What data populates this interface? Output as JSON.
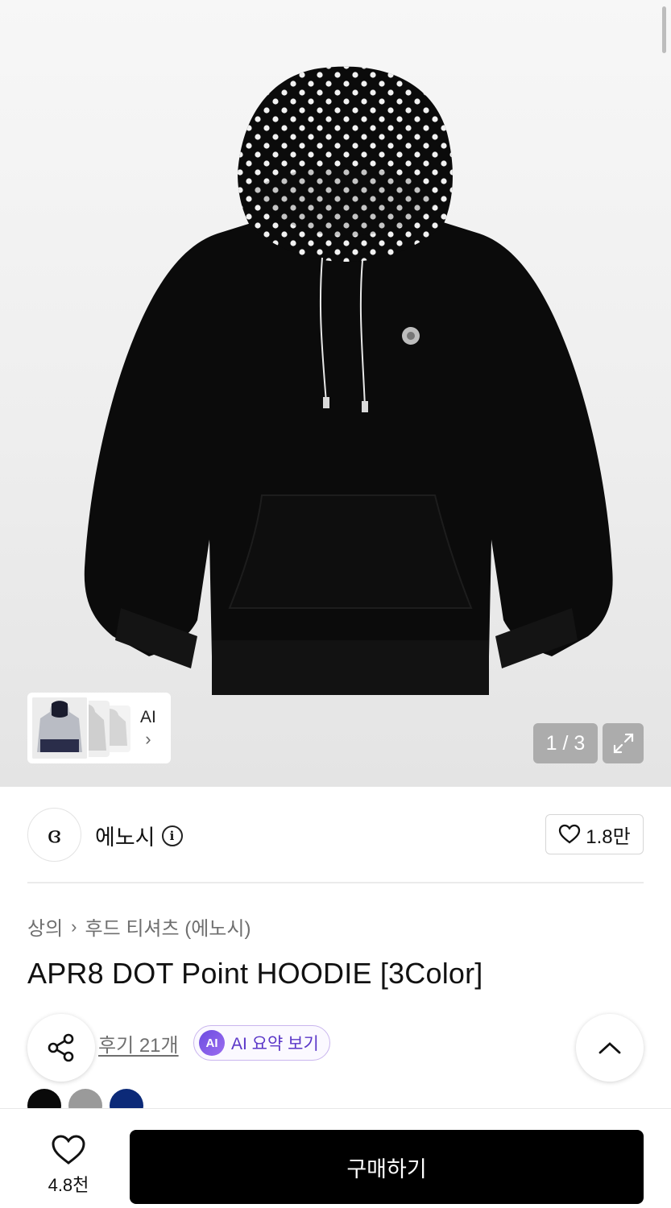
{
  "gallery": {
    "counter": "1 / 3",
    "ai_thumb_label": "AI",
    "ai_thumb_chevron": "›"
  },
  "brand": {
    "logo_glyph": "ɞ",
    "name": "에노시",
    "info_glyph": "i",
    "likes": "1.8만"
  },
  "breadcrumb": {
    "category": "상의",
    "separator": "›",
    "subcategory": "후드 티셔츠 (에노시)"
  },
  "product": {
    "title": "APR8 DOT Point HOODIE [3Color]"
  },
  "reviews": {
    "link": "후기 21개",
    "ai_badge": "AI",
    "ai_summary": "AI 요약 보기"
  },
  "colors": {
    "swatches": [
      "#0a0a0a",
      "#9a9a9a",
      "#0c2a78"
    ],
    "accent": "#6c4de0"
  },
  "bottom_bar": {
    "wish_count": "4.8천",
    "buy_label": "구매하기"
  }
}
